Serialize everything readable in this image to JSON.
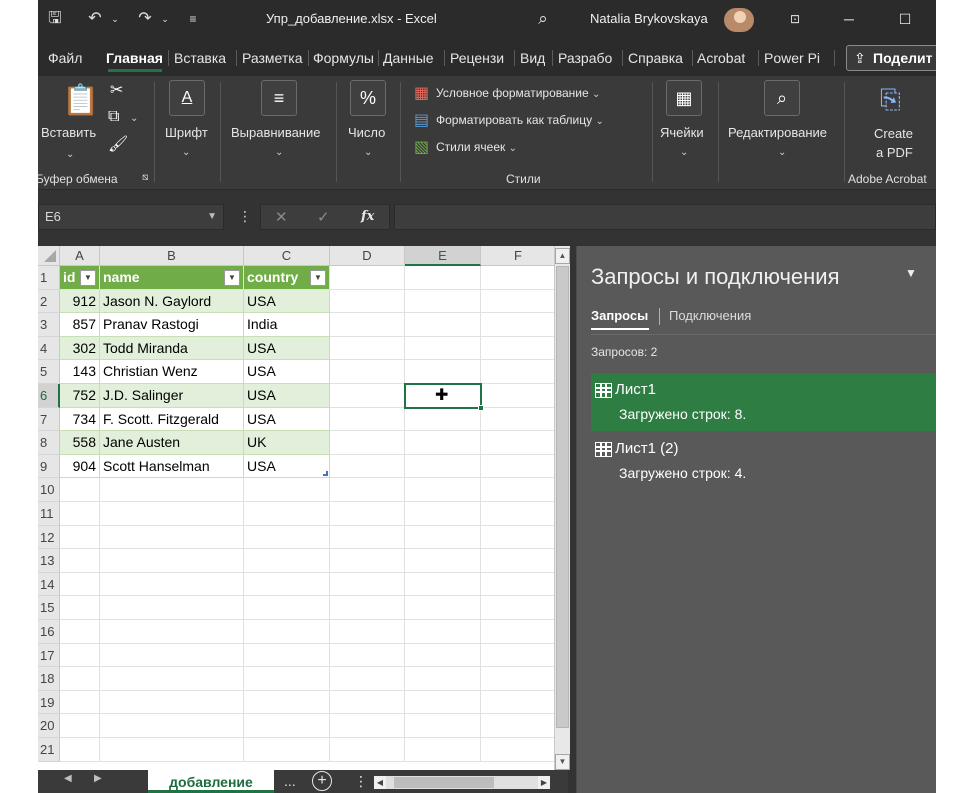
{
  "titlebar": {
    "document_title": "Упр_добавление.xlsx  -  Excel",
    "user_name": "Natalia Brykovskaya"
  },
  "ribbon_tabs": [
    "Файл",
    "Главная",
    "Вставка",
    "Разметка",
    "Формулы",
    "Данные",
    "Рецензи",
    "Вид",
    "Разрабо",
    "Справка",
    "Acrobat",
    "Power Pi"
  ],
  "share_label": "Поделит",
  "ribbon": {
    "paste": "Вставить",
    "font": "Шрифт",
    "alignment": "Выравнивание",
    "number": "Число",
    "conditional_formatting": "Условное форматирование",
    "format_as_table": "Форматировать как таблицу",
    "cell_styles": "Стили ячеек",
    "cells": "Ячейки",
    "editing": "Редактирование",
    "create_pdf_line1": "Create",
    "create_pdf_line2": "a PDF",
    "group_clipboard": "Буфер обмена",
    "group_styles": "Стили",
    "group_acrobat": "Adobe Acrobat"
  },
  "formula_bar": {
    "name_box": "E6",
    "fx": "fx",
    "formula": ""
  },
  "grid": {
    "columns": [
      "A",
      "B",
      "C",
      "D",
      "E",
      "F"
    ],
    "selected_column": "E",
    "selected_row": 6,
    "row_numbers": [
      "1",
      "2",
      "3",
      "4",
      "5",
      "6",
      "7",
      "8",
      "9",
      "10",
      "11",
      "12",
      "13",
      "14",
      "15",
      "16",
      "17",
      "18",
      "19",
      "20",
      "21"
    ],
    "table_headers": [
      "id",
      "name",
      "country"
    ],
    "rows": [
      {
        "id": "912",
        "name": "Jason N. Gaylord",
        "country": "USA"
      },
      {
        "id": "857",
        "name": "Pranav Rastogi",
        "country": "India"
      },
      {
        "id": "302",
        "name": "Todd Miranda",
        "country": "USA"
      },
      {
        "id": "143",
        "name": "Christian Wenz",
        "country": "USA"
      },
      {
        "id": "752",
        "name": "J.D. Salinger",
        "country": "USA"
      },
      {
        "id": "734",
        "name": "F. Scott. Fitzgerald",
        "country": "USA"
      },
      {
        "id": "558",
        "name": "Jane Austen",
        "country": "UK"
      },
      {
        "id": "904",
        "name": "Scott Hanselman",
        "country": "USA"
      }
    ]
  },
  "sheet_tabs": {
    "active": "добавление",
    "more": "..."
  },
  "queries_pane": {
    "title": "Запросы и подключения",
    "tab_queries": "Запросы",
    "tab_connections": "Подключения",
    "count_label": "Запросов: 2",
    "items": [
      {
        "name": "Лист1",
        "status": "Загружено строк: 8."
      },
      {
        "name": "Лист1 (2)",
        "status": "Загружено строк: 4."
      }
    ]
  },
  "colors": {
    "accent": "#217346",
    "table_header": "#70ad47",
    "table_band": "#e2efda",
    "query_selected": "#2e7d43"
  }
}
